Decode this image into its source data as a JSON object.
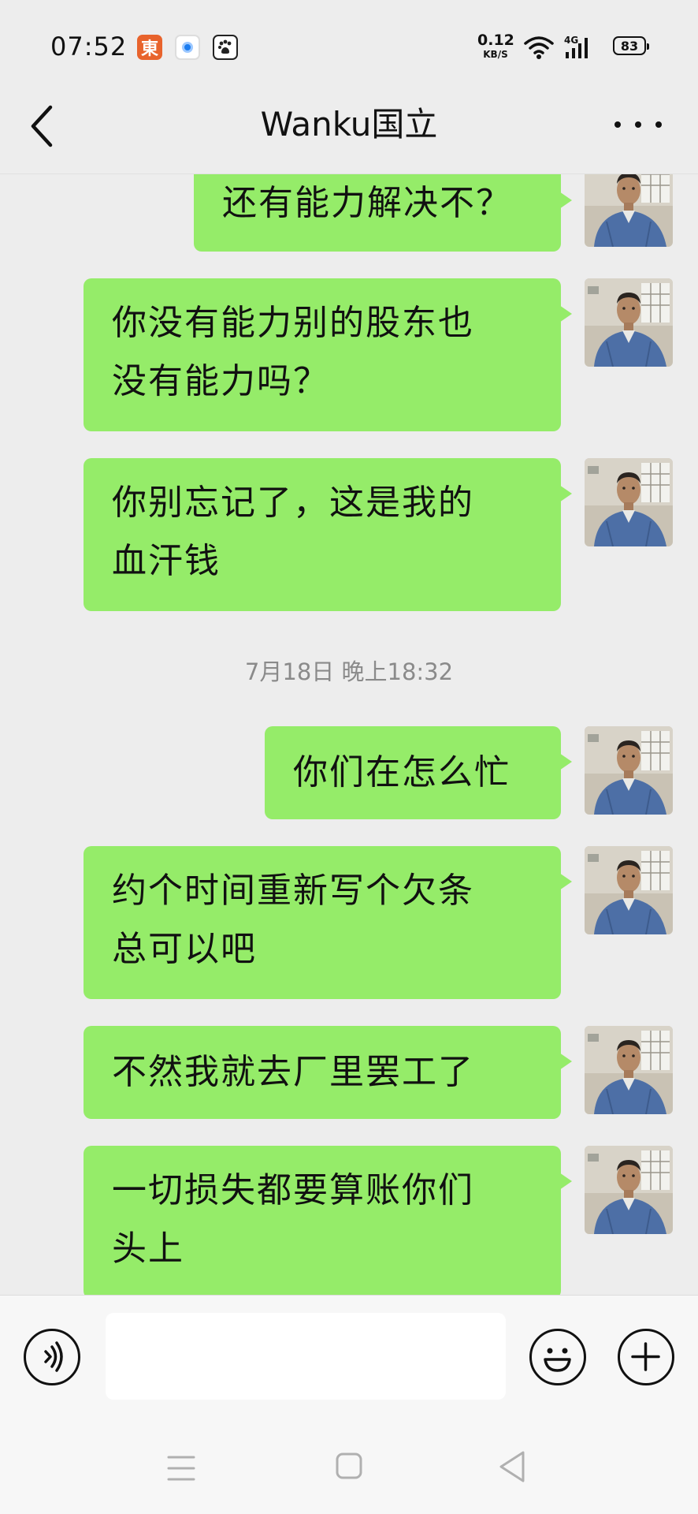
{
  "status_bar": {
    "time": "07:52",
    "net_speed_value": "0.12",
    "net_speed_unit": "KB/S",
    "signal_label": "4G",
    "battery_level": "83",
    "app_icons": [
      "jd-icon",
      "browser-icon",
      "baidu-paw-icon"
    ]
  },
  "header": {
    "title": "Wanku国立"
  },
  "messages": [
    {
      "text": "还有能力解决不？"
    },
    {
      "line1": "你没有能力别的股东也",
      "line2": "没有能力吗？"
    },
    {
      "line1": "你别忘记了，这是我的",
      "line2": "血汗钱"
    },
    {
      "text": "你们在怎么忙"
    },
    {
      "line1": "约个时间重新写个欠条",
      "line2": "总可以吧"
    },
    {
      "text": "不然我就去厂里罢工了"
    },
    {
      "line1": "一切损失都要算账你们",
      "line2": "头上"
    }
  ],
  "timestamp": "7月18日 晚上18:32",
  "input": {
    "placeholder": ""
  },
  "colors": {
    "bubble_green": "#95ec69",
    "background": "#ededed",
    "timestamp_gray": "#8a8a8a"
  }
}
